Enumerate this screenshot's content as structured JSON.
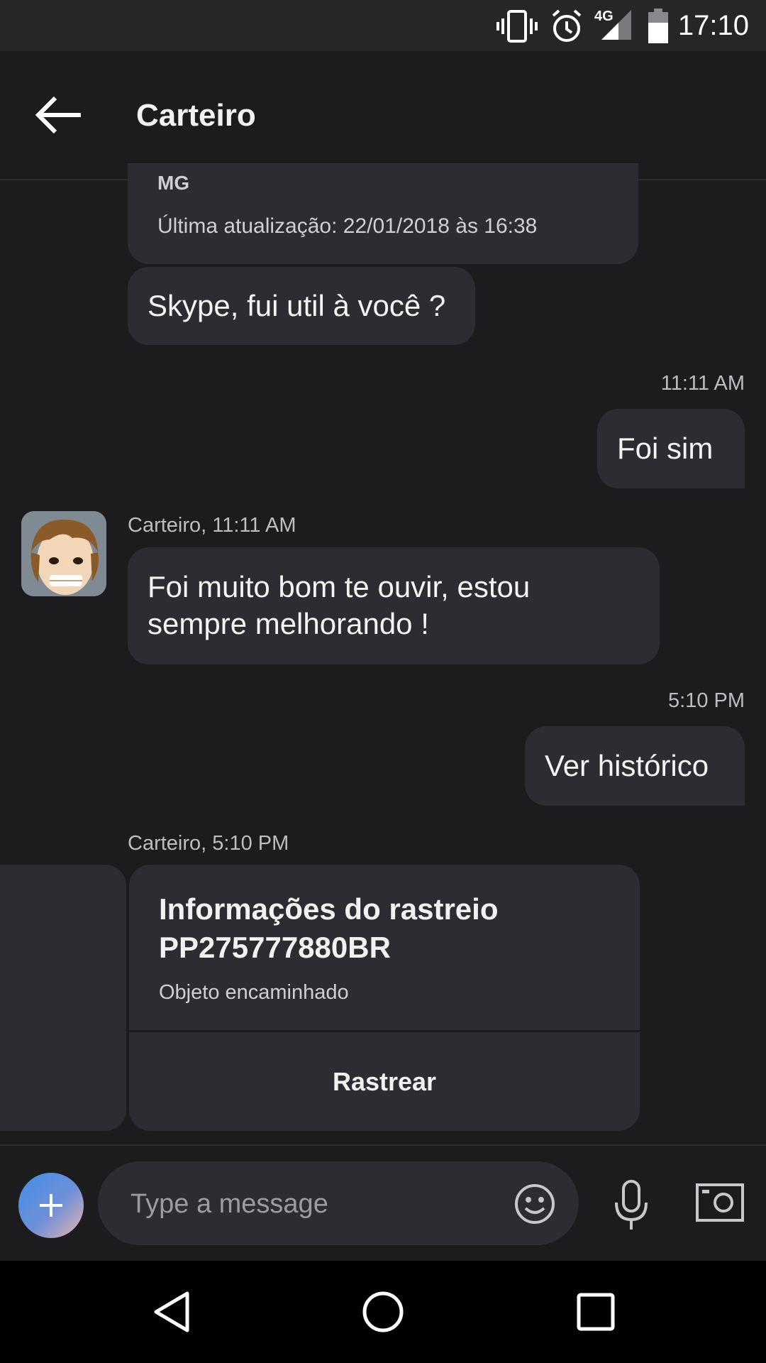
{
  "status_bar": {
    "time": "17:10",
    "network_label": "4G",
    "icons": [
      "vibrate-icon",
      "alarm-icon",
      "signal-icon",
      "battery-icon"
    ]
  },
  "header": {
    "title": "Carteiro",
    "back_icon": "back-arrow-icon"
  },
  "messages": {
    "prev_card": {
      "city": "MG",
      "updated": "Última atualização: 22/01/2018 às 16:38"
    },
    "bot_msg_1": "Skype, fui util à você ?",
    "out_time_1": "11:11 AM",
    "out_msg_1": "Foi sim",
    "bot_meta_2": "Carteiro, 11:11 AM",
    "bot_msg_2": "Foi muito bom te ouvir, estou sempre melhorando !",
    "out_time_2": "5:10 PM",
    "out_msg_2": "Ver histórico",
    "bot_meta_3": "Carteiro, 5:10 PM",
    "track_card": {
      "title": "Informações do rastreio PP275777880BR",
      "status": "Objeto encaminhado",
      "button": "Rastrear"
    }
  },
  "composer": {
    "placeholder": "Type a message",
    "icons": [
      "plus-icon",
      "emoji-icon",
      "microphone-icon",
      "camera-icon"
    ]
  },
  "nav": {
    "icons": [
      "nav-back-icon",
      "nav-home-icon",
      "nav-recents-icon"
    ]
  },
  "colors": {
    "background": "#1c1c1e",
    "bubble": "#2c2c32",
    "status_bar": "#262628",
    "accent_start": "#3f8ee6",
    "accent_end": "#e7b6b0"
  }
}
